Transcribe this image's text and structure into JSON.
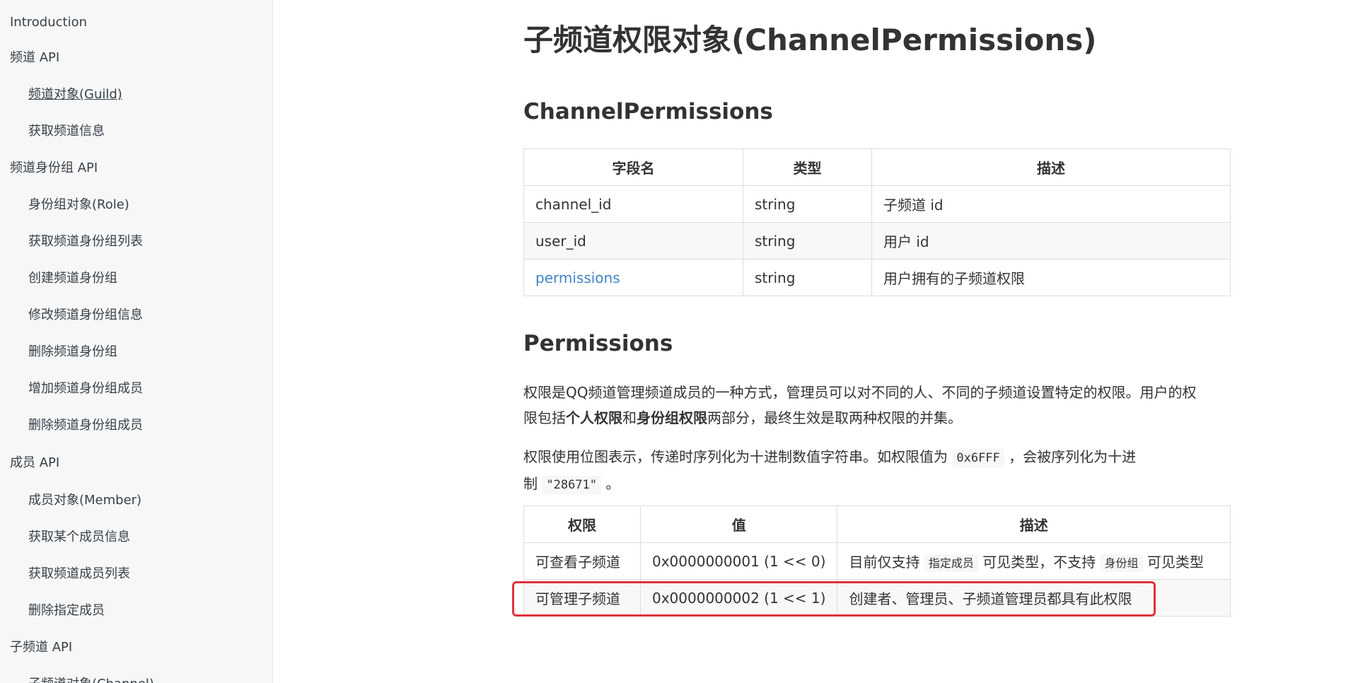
{
  "sidebar": {
    "items": [
      {
        "label": "Introduction",
        "level": 1
      },
      {
        "label": "频道 API",
        "level": 1
      },
      {
        "label": "频道对象(Guild)",
        "level": 2,
        "active": true
      },
      {
        "label": "获取频道信息",
        "level": 2
      },
      {
        "label": "频道身份组 API",
        "level": 1
      },
      {
        "label": "身份组对象(Role)",
        "level": 2
      },
      {
        "label": "获取频道身份组列表",
        "level": 2
      },
      {
        "label": "创建频道身份组",
        "level": 2
      },
      {
        "label": "修改频道身份组信息",
        "level": 2
      },
      {
        "label": "删除频道身份组",
        "level": 2
      },
      {
        "label": "增加频道身份组成员",
        "level": 2
      },
      {
        "label": "删除频道身份组成员",
        "level": 2
      },
      {
        "label": "成员 API",
        "level": 1
      },
      {
        "label": "成员对象(Member)",
        "level": 2
      },
      {
        "label": "获取某个成员信息",
        "level": 2
      },
      {
        "label": "获取频道成员列表",
        "level": 2
      },
      {
        "label": "删除指定成员",
        "level": 2
      },
      {
        "label": "子频道 API",
        "level": 1
      },
      {
        "label": "子频道对象(Channel)",
        "level": 2
      }
    ]
  },
  "main": {
    "title": "子频道权限对象(ChannelPermissions)",
    "section1": {
      "heading": "ChannelPermissions",
      "headers": [
        "字段名",
        "类型",
        "描述"
      ],
      "rows": [
        [
          "channel_id",
          "string",
          "子频道 id"
        ],
        [
          "user_id",
          "string",
          "用户 id"
        ],
        [
          "permissions",
          "string",
          "用户拥有的子频道权限"
        ]
      ]
    },
    "section2": {
      "heading": "Permissions",
      "para1": {
        "line1": "权限是QQ频道管理频道成员的一种方式，管理员可以对不同的人、不同的子频道设置特定的权限。用户的权",
        "line2_a": "限包括",
        "bold1": "个人权限",
        "mid": "和",
        "bold2": "身份组权限",
        "line2_b": "两部分，最终生效是取两种权限的并集。"
      },
      "para2": {
        "a": "权限使用位图表示，传递时序列化为十进制数值字符串。如权限值为",
        "code1": "0x6FFF",
        "b": "，会被序列化为十进",
        "c": "制",
        "code2": "\"28671\"",
        "d": "。"
      },
      "headers": [
        "权限",
        "值",
        "描述"
      ],
      "rows": [
        {
          "perm": "可查看子频道",
          "value": "0x0000000001 (1 << 0)",
          "desc_a": "目前仅支持",
          "desc_code1": "指定成员",
          "desc_b": "可见类型，不支持",
          "desc_code2": "身份组",
          "desc_c": "可见类型"
        },
        {
          "perm": "可管理子频道",
          "value": "0x0000000002 (1 << 1)",
          "desc": "创建者、管理员、子频道管理员都具有此权限"
        }
      ]
    }
  }
}
